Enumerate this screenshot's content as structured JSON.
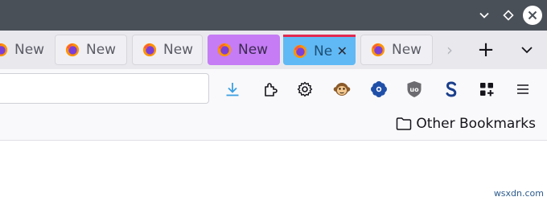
{
  "window_controls": [
    "minimize",
    "maximize",
    "close"
  ],
  "tabs": [
    {
      "label": "New",
      "active": false,
      "bg": "#e9e9ed",
      "color": "#5b5b66"
    },
    {
      "label": "New",
      "active": false,
      "bg": "#f0f0f4",
      "color": "#5b5b66"
    },
    {
      "label": "New",
      "active": false,
      "bg": "#f0f0f4",
      "color": "#5b5b66"
    },
    {
      "label": "New",
      "active": false,
      "bg": "#c57cf5",
      "color": "#3b2a4f"
    },
    {
      "label": "Ne",
      "active": true,
      "bg": "#60b9f5",
      "color": "#1d4f74",
      "accent": "#e22850",
      "close_glyph": "✕"
    },
    {
      "label": "New",
      "active": false,
      "bg": "#f0f0f4",
      "color": "#5b5b66"
    }
  ],
  "tabstrip": {
    "overflow_glyph": "›",
    "new_tab_glyph": "+"
  },
  "toolbar_icons": [
    "download-icon",
    "extensions-icon",
    "settings-icon",
    "monkey-extension-icon",
    "flower-extension-icon",
    "ublock-icon",
    "s-extension-icon",
    "apps-grid-icon",
    "menu-icon"
  ],
  "bookmarks": {
    "label": "Other Bookmarks"
  },
  "watermark": "wsxdn.com",
  "colors": {
    "titlebar": "#4a5058",
    "tabstrip": "#e9e9ed",
    "download": "#3c9fe3",
    "accent": "#e22850"
  }
}
